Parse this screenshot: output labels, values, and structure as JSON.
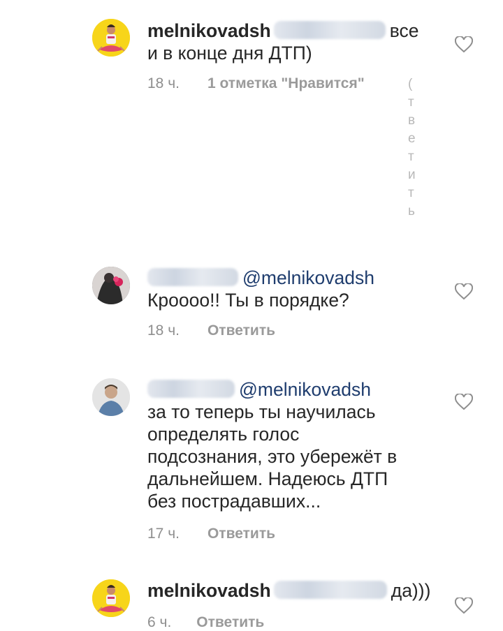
{
  "comments": [
    {
      "username": "melnikovadsh",
      "text_inline": "все",
      "text_rest": "и в конце дня ДТП)",
      "time": "18 ч.",
      "action": "1 отметка \"Нравится\"",
      "cut_column": [
        "(",
        "т",
        "в",
        "е",
        "т",
        "и",
        "т",
        "ь"
      ]
    },
    {
      "mention": "@melnikovadsh",
      "text": "Кроооо!! Ты в порядке?",
      "time": "18 ч.",
      "action": "Ответить"
    },
    {
      "mention": "@melnikovadsh",
      "lines": [
        "за то теперь ты научилась",
        "определять голос",
        "подсознания, это убережёт в",
        "дальнейшем. Надеюсь ДТП",
        "без пострадавших..."
      ],
      "time": "17 ч.",
      "action": "Ответить"
    },
    {
      "username": "melnikovadsh",
      "text_inline": "да)))",
      "time": "6 ч.",
      "action": "Ответить"
    }
  ],
  "icons": {
    "like": "heart-outline-icon",
    "avatar_1": "avatar-yellow-meditation",
    "avatar_2": "avatar-dark-flowers",
    "avatar_3": "avatar-man-photo"
  },
  "colors": {
    "text": "#262626",
    "meta": "#8e8e8e",
    "mention": "#1f3d6e",
    "avatar_yellow": "#f7d51a"
  }
}
